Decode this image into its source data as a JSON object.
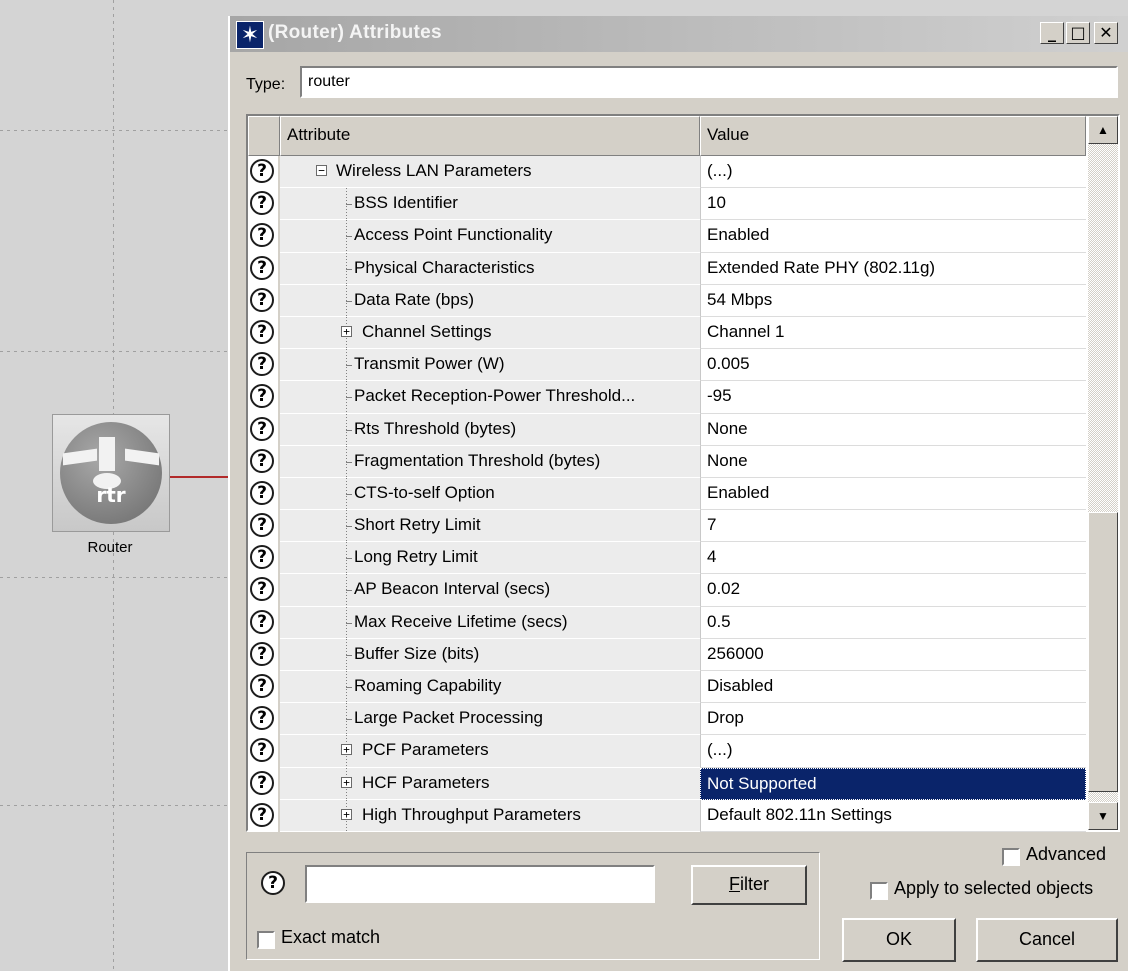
{
  "canvas": {
    "router_label": "Router",
    "router_icon_text": "rtr"
  },
  "dialog": {
    "title": "(Router) Attributes",
    "type_label": "Type:",
    "type_value": "router",
    "header_attribute": "Attribute",
    "header_value": "Value",
    "rows": [
      {
        "attr": "Wireless LAN Parameters",
        "value": "(...)",
        "kind": "group-open",
        "level": 0
      },
      {
        "attr": "BSS Identifier",
        "value": "10",
        "kind": "leaf",
        "level": 1
      },
      {
        "attr": "Access Point Functionality",
        "value": "Enabled",
        "kind": "leaf",
        "level": 1
      },
      {
        "attr": "Physical Characteristics",
        "value": "Extended Rate PHY (802.11g)",
        "kind": "leaf",
        "level": 1
      },
      {
        "attr": "Data Rate (bps)",
        "value": "54 Mbps",
        "kind": "leaf",
        "level": 1
      },
      {
        "attr": "Channel Settings",
        "value": "Channel 1",
        "kind": "group-closed",
        "level": 1
      },
      {
        "attr": "Transmit Power (W)",
        "value": "0.005",
        "kind": "leaf",
        "level": 1
      },
      {
        "attr": "Packet Reception-Power Threshold...",
        "value": "-95",
        "kind": "leaf",
        "level": 1
      },
      {
        "attr": "Rts Threshold (bytes)",
        "value": "None",
        "kind": "leaf",
        "level": 1
      },
      {
        "attr": "Fragmentation Threshold (bytes)",
        "value": "None",
        "kind": "leaf",
        "level": 1
      },
      {
        "attr": "CTS-to-self Option",
        "value": "Enabled",
        "kind": "leaf",
        "level": 1
      },
      {
        "attr": "Short Retry Limit",
        "value": "7",
        "kind": "leaf",
        "level": 1
      },
      {
        "attr": "Long Retry Limit",
        "value": "4",
        "kind": "leaf",
        "level": 1
      },
      {
        "attr": "AP Beacon Interval (secs)",
        "value": "0.02",
        "kind": "leaf",
        "level": 1
      },
      {
        "attr": "Max Receive Lifetime (secs)",
        "value": "0.5",
        "kind": "leaf",
        "level": 1
      },
      {
        "attr": "Buffer Size (bits)",
        "value": "256000",
        "kind": "leaf",
        "level": 1
      },
      {
        "attr": "Roaming Capability",
        "value": "Disabled",
        "kind": "leaf",
        "level": 1
      },
      {
        "attr": "Large Packet Processing",
        "value": "Drop",
        "kind": "leaf",
        "level": 1
      },
      {
        "attr": "PCF Parameters",
        "value": "(...)",
        "kind": "group-closed",
        "level": 1
      },
      {
        "attr": "HCF Parameters",
        "value": "Not Supported",
        "kind": "group-closed",
        "level": 1,
        "selected": true
      },
      {
        "attr": "High Throughput Parameters",
        "value": "Default 802.11n Settings",
        "kind": "group-closed",
        "level": 1
      }
    ],
    "filter_value": "",
    "filter_button": "Filter",
    "exact_match": "Exact match",
    "advanced": "Advanced",
    "apply_selected": "Apply to selected objects",
    "ok": "OK",
    "cancel": "Cancel"
  },
  "colors": {
    "selection": "#0a246a",
    "link": "#b22a2a",
    "window_face": "#d4d0c8"
  }
}
